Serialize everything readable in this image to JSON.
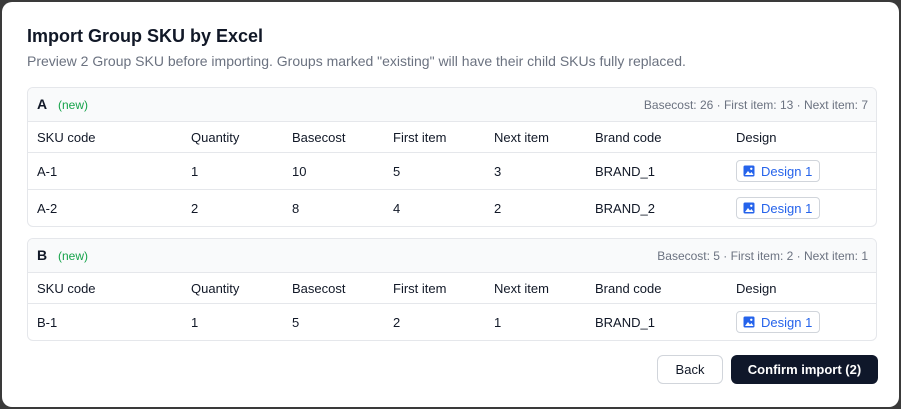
{
  "dialog": {
    "title": "Import Group SKU by Excel",
    "subtitle": "Preview 2 Group SKU before importing. Groups marked \"existing\" will have their child SKUs fully replaced."
  },
  "columns": [
    "SKU code",
    "Quantity",
    "Basecost",
    "First item",
    "Next item",
    "Brand code",
    "Design"
  ],
  "groups": [
    {
      "name": "A",
      "tag": "(new)",
      "summary": "Basecost: 26 · First item: 13 · Next item: 7",
      "rows": [
        {
          "sku": "A-1",
          "quantity": "1",
          "basecost": "10",
          "first_item": "5",
          "next_item": "3",
          "brand": "BRAND_1",
          "design": "Design 1"
        },
        {
          "sku": "A-2",
          "quantity": "2",
          "basecost": "8",
          "first_item": "4",
          "next_item": "2",
          "brand": "BRAND_2",
          "design": "Design 1"
        }
      ]
    },
    {
      "name": "B",
      "tag": "(new)",
      "summary": "Basecost: 5 · First item: 2 · Next item: 1",
      "rows": [
        {
          "sku": "B-1",
          "quantity": "1",
          "basecost": "5",
          "first_item": "2",
          "next_item": "1",
          "brand": "BRAND_1",
          "design": "Design 1"
        }
      ]
    }
  ],
  "footer": {
    "back_label": "Back",
    "confirm_label": "Confirm import (2)"
  },
  "icons": {
    "design": "image-icon"
  },
  "colors": {
    "new_tag": "#16a34a",
    "link": "#2563eb",
    "primary_button": "#0f172a"
  }
}
